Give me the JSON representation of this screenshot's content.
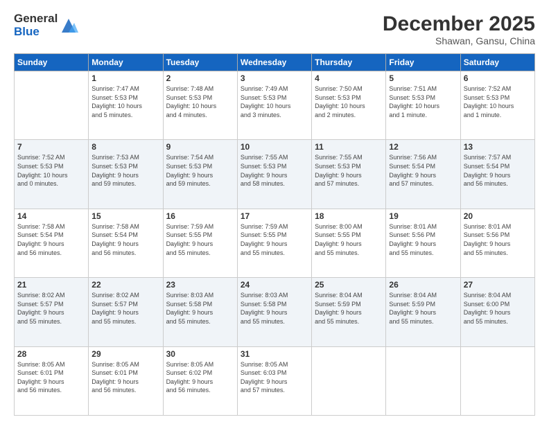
{
  "header": {
    "logo_general": "General",
    "logo_blue": "Blue",
    "month_title": "December 2025",
    "location": "Shawan, Gansu, China"
  },
  "days_of_week": [
    "Sunday",
    "Monday",
    "Tuesday",
    "Wednesday",
    "Thursday",
    "Friday",
    "Saturday"
  ],
  "weeks": [
    [
      {
        "day": "",
        "info": ""
      },
      {
        "day": "1",
        "info": "Sunrise: 7:47 AM\nSunset: 5:53 PM\nDaylight: 10 hours\nand 5 minutes."
      },
      {
        "day": "2",
        "info": "Sunrise: 7:48 AM\nSunset: 5:53 PM\nDaylight: 10 hours\nand 4 minutes."
      },
      {
        "day": "3",
        "info": "Sunrise: 7:49 AM\nSunset: 5:53 PM\nDaylight: 10 hours\nand 3 minutes."
      },
      {
        "day": "4",
        "info": "Sunrise: 7:50 AM\nSunset: 5:53 PM\nDaylight: 10 hours\nand 2 minutes."
      },
      {
        "day": "5",
        "info": "Sunrise: 7:51 AM\nSunset: 5:53 PM\nDaylight: 10 hours\nand 1 minute."
      },
      {
        "day": "6",
        "info": "Sunrise: 7:52 AM\nSunset: 5:53 PM\nDaylight: 10 hours\nand 1 minute."
      }
    ],
    [
      {
        "day": "7",
        "info": "Sunrise: 7:52 AM\nSunset: 5:53 PM\nDaylight: 10 hours\nand 0 minutes."
      },
      {
        "day": "8",
        "info": "Sunrise: 7:53 AM\nSunset: 5:53 PM\nDaylight: 9 hours\nand 59 minutes."
      },
      {
        "day": "9",
        "info": "Sunrise: 7:54 AM\nSunset: 5:53 PM\nDaylight: 9 hours\nand 59 minutes."
      },
      {
        "day": "10",
        "info": "Sunrise: 7:55 AM\nSunset: 5:53 PM\nDaylight: 9 hours\nand 58 minutes."
      },
      {
        "day": "11",
        "info": "Sunrise: 7:55 AM\nSunset: 5:53 PM\nDaylight: 9 hours\nand 57 minutes."
      },
      {
        "day": "12",
        "info": "Sunrise: 7:56 AM\nSunset: 5:54 PM\nDaylight: 9 hours\nand 57 minutes."
      },
      {
        "day": "13",
        "info": "Sunrise: 7:57 AM\nSunset: 5:54 PM\nDaylight: 9 hours\nand 56 minutes."
      }
    ],
    [
      {
        "day": "14",
        "info": "Sunrise: 7:58 AM\nSunset: 5:54 PM\nDaylight: 9 hours\nand 56 minutes."
      },
      {
        "day": "15",
        "info": "Sunrise: 7:58 AM\nSunset: 5:54 PM\nDaylight: 9 hours\nand 56 minutes."
      },
      {
        "day": "16",
        "info": "Sunrise: 7:59 AM\nSunset: 5:55 PM\nDaylight: 9 hours\nand 55 minutes."
      },
      {
        "day": "17",
        "info": "Sunrise: 7:59 AM\nSunset: 5:55 PM\nDaylight: 9 hours\nand 55 minutes."
      },
      {
        "day": "18",
        "info": "Sunrise: 8:00 AM\nSunset: 5:55 PM\nDaylight: 9 hours\nand 55 minutes."
      },
      {
        "day": "19",
        "info": "Sunrise: 8:01 AM\nSunset: 5:56 PM\nDaylight: 9 hours\nand 55 minutes."
      },
      {
        "day": "20",
        "info": "Sunrise: 8:01 AM\nSunset: 5:56 PM\nDaylight: 9 hours\nand 55 minutes."
      }
    ],
    [
      {
        "day": "21",
        "info": "Sunrise: 8:02 AM\nSunset: 5:57 PM\nDaylight: 9 hours\nand 55 minutes."
      },
      {
        "day": "22",
        "info": "Sunrise: 8:02 AM\nSunset: 5:57 PM\nDaylight: 9 hours\nand 55 minutes."
      },
      {
        "day": "23",
        "info": "Sunrise: 8:03 AM\nSunset: 5:58 PM\nDaylight: 9 hours\nand 55 minutes."
      },
      {
        "day": "24",
        "info": "Sunrise: 8:03 AM\nSunset: 5:58 PM\nDaylight: 9 hours\nand 55 minutes."
      },
      {
        "day": "25",
        "info": "Sunrise: 8:04 AM\nSunset: 5:59 PM\nDaylight: 9 hours\nand 55 minutes."
      },
      {
        "day": "26",
        "info": "Sunrise: 8:04 AM\nSunset: 5:59 PM\nDaylight: 9 hours\nand 55 minutes."
      },
      {
        "day": "27",
        "info": "Sunrise: 8:04 AM\nSunset: 6:00 PM\nDaylight: 9 hours\nand 55 minutes."
      }
    ],
    [
      {
        "day": "28",
        "info": "Sunrise: 8:05 AM\nSunset: 6:01 PM\nDaylight: 9 hours\nand 56 minutes."
      },
      {
        "day": "29",
        "info": "Sunrise: 8:05 AM\nSunset: 6:01 PM\nDaylight: 9 hours\nand 56 minutes."
      },
      {
        "day": "30",
        "info": "Sunrise: 8:05 AM\nSunset: 6:02 PM\nDaylight: 9 hours\nand 56 minutes."
      },
      {
        "day": "31",
        "info": "Sunrise: 8:05 AM\nSunset: 6:03 PM\nDaylight: 9 hours\nand 57 minutes."
      },
      {
        "day": "",
        "info": ""
      },
      {
        "day": "",
        "info": ""
      },
      {
        "day": "",
        "info": ""
      }
    ]
  ]
}
